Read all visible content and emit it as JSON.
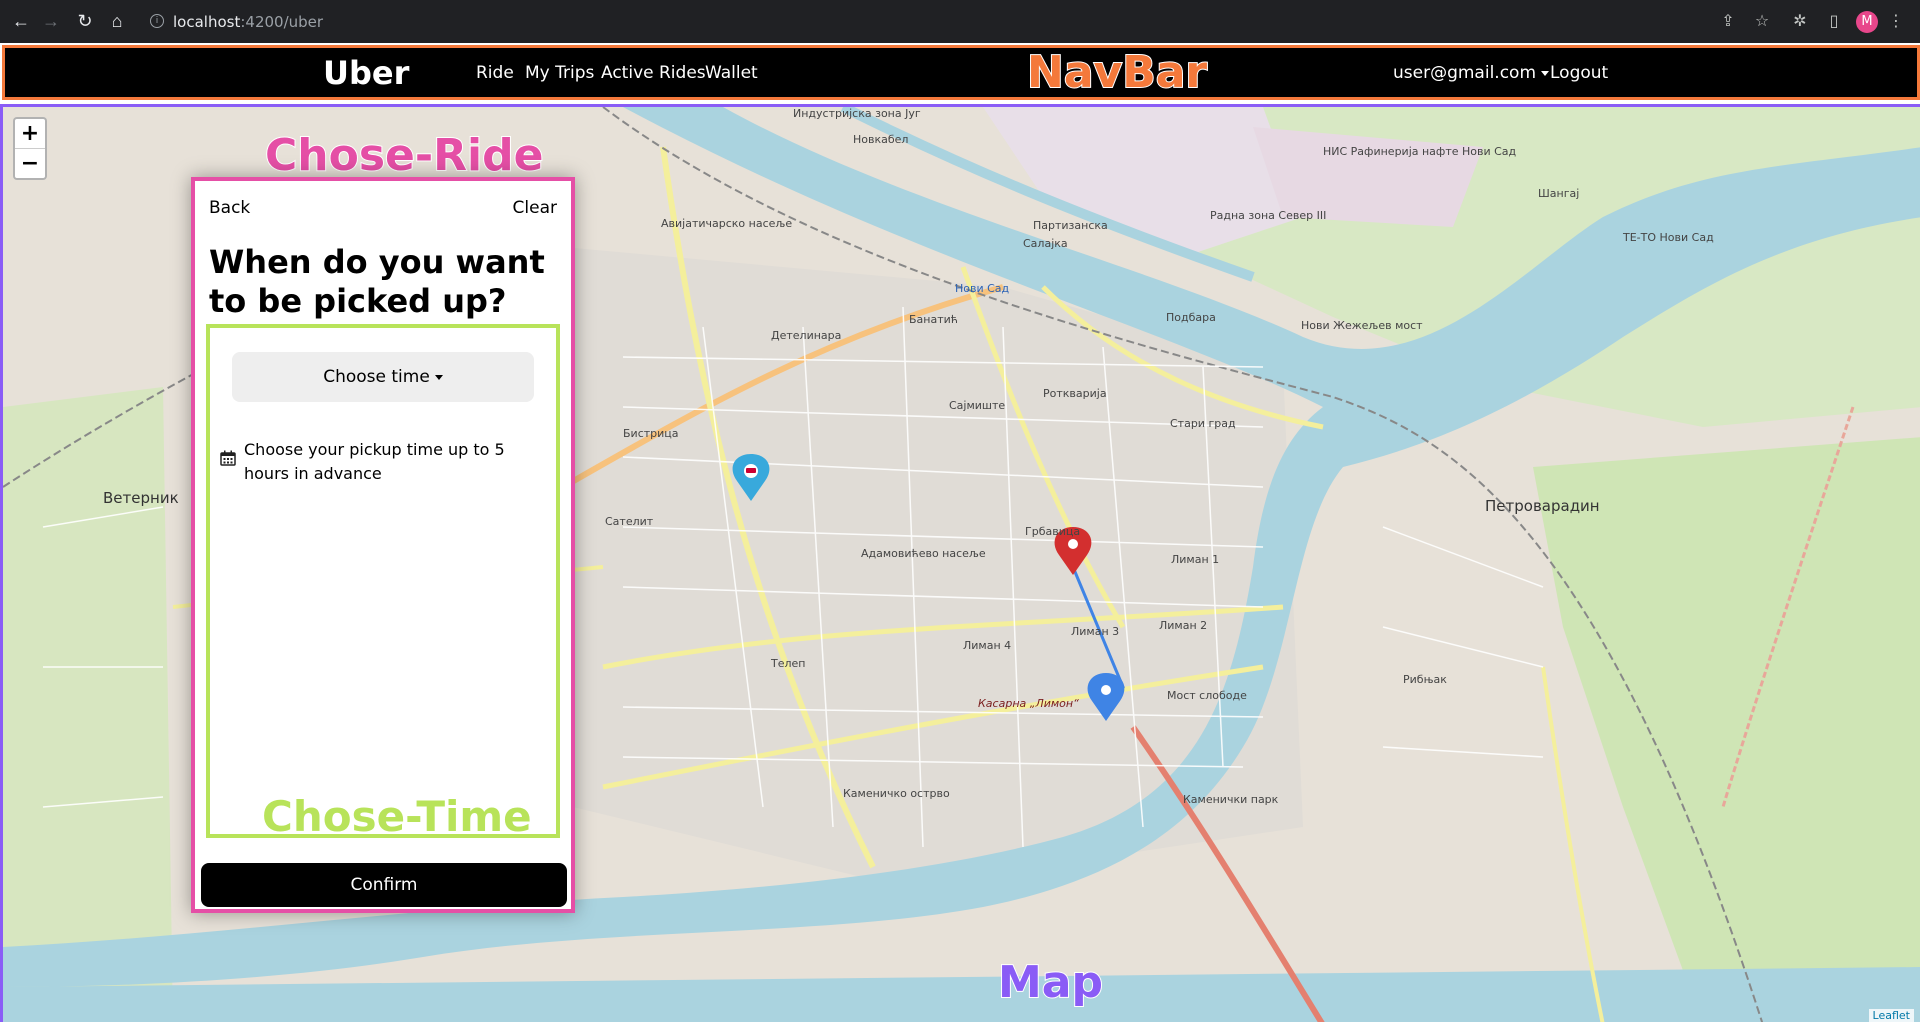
{
  "browser": {
    "url_host": "localhost",
    "url_path": ":4200/uber",
    "profile_initial": "M"
  },
  "navbar": {
    "brand": "Uber",
    "links": [
      "Ride",
      "My Trips",
      "Active Rides",
      "Wallet"
    ],
    "user": "user@gmail.com",
    "logout": "Logout",
    "overlay_label": "NavBar"
  },
  "map": {
    "overlay_label": "Map",
    "zoom_in": "+",
    "zoom_out": "−",
    "attribution": "Leaflet",
    "labels": [
      "Индустријска зона Југ",
      "Новкабел",
      "НИС Рафинерија нафте Нови Сад",
      "Шангај",
      "ТЕ-ТО Нови Сад",
      "Авијатичарско насеље",
      "Партизанска",
      "Салајка",
      "Радна зона Север III",
      "Нови Сад",
      "Детелинара",
      "Банатић",
      "Подбара",
      "Нови Жежељев мост",
      "Роткварија",
      "Сајмиште",
      "Стари град",
      "Бистрица",
      "Ветерник",
      "Сателит",
      "Грбавица",
      "Лиман 1",
      "Адамовићево насеље",
      "Петроварадин",
      "Лиман 3",
      "Лиман 2",
      "Лиман 4",
      "Телеп",
      "Мост слободе",
      "Рибњак",
      "Каменичко острво",
      "Каменички парк",
      "Касарна „Лимон“"
    ]
  },
  "ride_panel": {
    "overlay_label": "Chose-Ride",
    "back": "Back",
    "clear": "Clear",
    "question": "When do you want to be picked up?",
    "confirm": "Confirm"
  },
  "time_panel": {
    "overlay_label": "Chose-Time",
    "choose_time": "Choose time",
    "hint": "Choose your pickup time up to 5 hours in advance"
  },
  "colors": {
    "navbar_outline": "#f4793b",
    "map_outline": "#8a5cf6",
    "ride_outline": "#e54fa6",
    "time_outline": "#b8e35a",
    "river": "#aad3df",
    "route": "#3f84e5"
  }
}
